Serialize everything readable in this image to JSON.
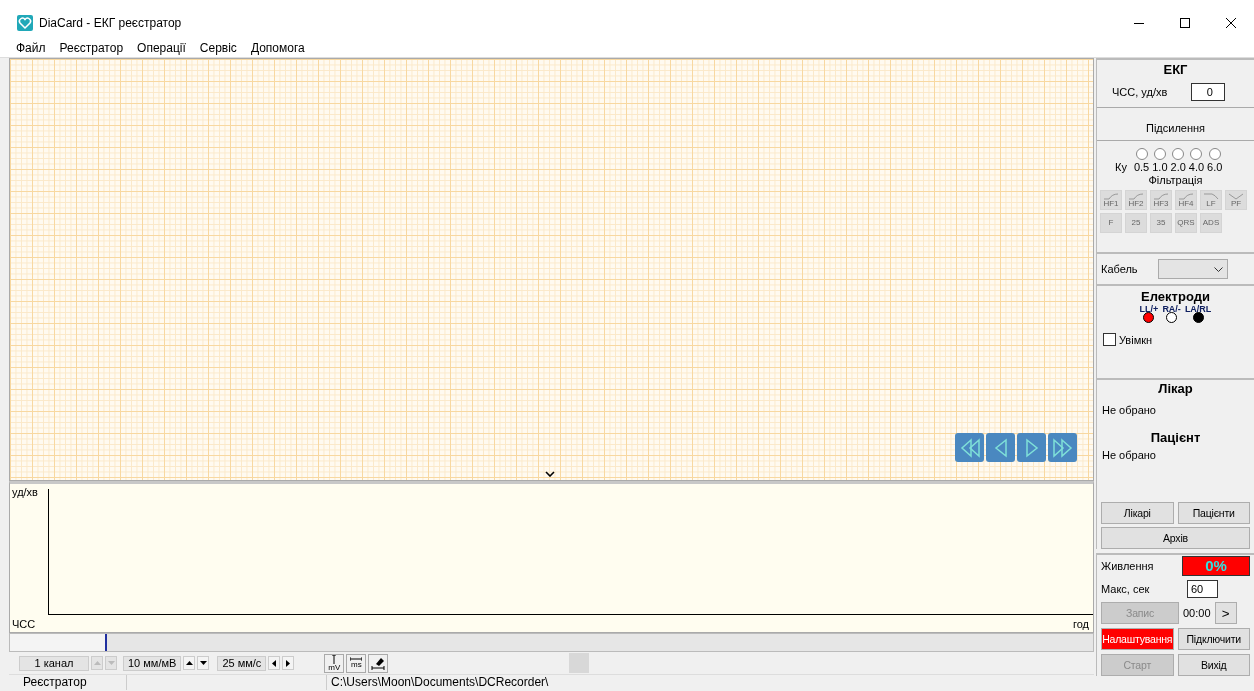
{
  "window": {
    "title": "DiaCard - ЕКГ реєстратор"
  },
  "menu": [
    "Файл",
    "Реєстратор",
    "Операції",
    "Сервіс",
    "Допомога"
  ],
  "trend": {
    "y_label": "уд/хв",
    "x_label_left": "ЧСС",
    "x_label_right": "год"
  },
  "toolbar": {
    "channels": "1 канал",
    "gain": "10 мм/мВ",
    "speed": "25 мм/с",
    "tools": [
      {
        "kind": "amplitude",
        "label": "mV"
      },
      {
        "kind": "duration",
        "label": "ms"
      },
      {
        "kind": "eraser"
      }
    ]
  },
  "ecg": {
    "title": "ЕКГ",
    "hr_label": "ЧСС, уд/хв",
    "hr_value": "0",
    "gain_title": "Підсилення",
    "gain_label": "Ку",
    "gains": [
      {
        "label": "0.5",
        "selected": false
      },
      {
        "label": "1.0",
        "selected": false
      },
      {
        "label": "2.0",
        "selected": false
      },
      {
        "label": "4.0",
        "selected": false
      },
      {
        "label": "6.0",
        "selected": false
      }
    ],
    "filter_title": "Фільтрація",
    "filters": [
      {
        "kind": "highpass",
        "label": "HF1",
        "disabled": true
      },
      {
        "kind": "highpass",
        "label": "HF2",
        "disabled": true
      },
      {
        "kind": "highpass",
        "label": "HF3",
        "disabled": true
      },
      {
        "kind": "highpass",
        "label": "HF4",
        "disabled": true
      },
      {
        "kind": "lowpass",
        "label": "LF",
        "disabled": true
      },
      {
        "kind": "notch",
        "label": "PF",
        "disabled": true
      },
      {
        "kind": "text",
        "label": "F",
        "disabled": true
      },
      {
        "kind": "text",
        "label": "25",
        "disabled": true
      },
      {
        "kind": "text",
        "label": "35",
        "disabled": true
      },
      {
        "kind": "text",
        "label": "QRS",
        "disabled": true
      },
      {
        "kind": "text",
        "label": "ADS",
        "disabled": true
      }
    ]
  },
  "cable": {
    "label": "Кабель"
  },
  "electrodes": {
    "title": "Електроди",
    "leads": [
      {
        "label": "LL/+",
        "color": "#ff0000"
      },
      {
        "label": "RA/-",
        "color": "#ffffff"
      },
      {
        "label": "LA/RL",
        "color": "#000000"
      }
    ],
    "enable": {
      "label": "Увімкн",
      "checked": false
    }
  },
  "doctor": {
    "title": "Лікар",
    "value": "Не обрано"
  },
  "patient": {
    "title": "Пацієнт",
    "value": "Не обрано"
  },
  "list_buttons": [
    {
      "label": "Лікарі",
      "disabled": false
    },
    {
      "label": "Пацієнти",
      "disabled": false
    },
    {
      "label": "Архів",
      "disabled": false
    }
  ],
  "power": {
    "label": "Живлення",
    "value": "0%"
  },
  "max_time": {
    "label": "Макс, сек",
    "value": "60"
  },
  "record": {
    "button": {
      "label": "Запис",
      "disabled": true
    },
    "time": "00:00",
    "next": ">"
  },
  "actions": [
    {
      "label": "Налаштування",
      "disabled": false,
      "alert": true
    },
    {
      "label": "Підключити",
      "disabled": false,
      "alert": false
    },
    {
      "label": "Старт",
      "disabled": true,
      "alert": false
    },
    {
      "label": "Вихід",
      "disabled": false,
      "alert": false
    }
  ],
  "status_bar": {
    "mode": "Реєстратор",
    "path": "C:\\Users\\Moon\\Documents\\DCRecorder\\"
  }
}
